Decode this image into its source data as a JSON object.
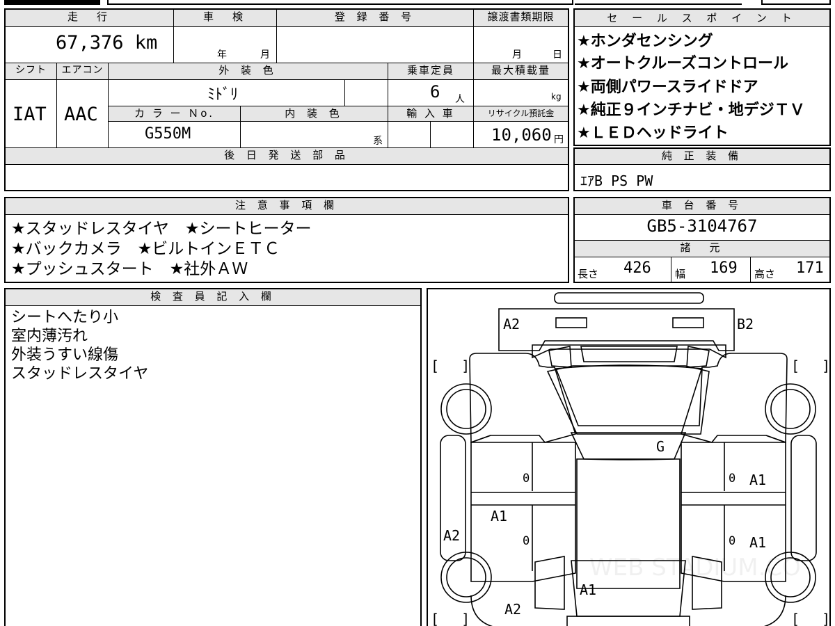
{
  "main": {
    "mileage_header": "走　行",
    "inspection_header": "車　検",
    "registration_header": "登 録 番 号",
    "transfer_header": "譲渡書類期限",
    "mileage": "67,376 km",
    "inspection_year": "年",
    "inspection_month": "月",
    "transfer_month": "月",
    "transfer_day": "日",
    "shift_header": "シフト",
    "ac_header": "エアコン",
    "exterior_header": "外 装 色",
    "capacity_header": "乗車定員",
    "load_header": "最大積載量",
    "shift": "IAT",
    "ac": "AAC",
    "exterior_color": "ﾐﾄﾞﾘ",
    "capacity": "6",
    "capacity_unit": "人",
    "load_unit": "kg",
    "colorno_header": "カ ラ ー Ｎo.",
    "interior_header": "内 装 色",
    "import_header": "輸 入 車",
    "recycle_header": "リサイクル預託金",
    "color_no": "G550M",
    "interior_unit": "系",
    "recycle_fee": "10,060",
    "recycle_unit": "円",
    "later_parts_header": "後 日 発 送 部 品"
  },
  "sales_points": {
    "header": "セ ー ル ス ポ イ ン ト",
    "items": [
      "★ホンダセンシング",
      "★オートクルーズコントロール",
      "★両側パワースライドドア",
      "★純正９インチナビ・地デジＴＶ",
      "★ＬＥＤヘッドライト"
    ]
  },
  "equipment": {
    "header": "純 正 装 備",
    "value": "ｴｱB PS PW"
  },
  "notes": {
    "header": "注 意 事 項 欄",
    "lines": [
      "★スタッドレスタイヤ　★シートヒーター",
      "★バックカメラ　★ビルトインＥＴＣ",
      "★プッシュスタート　★社外ＡＷ"
    ]
  },
  "chassis": {
    "header": "車 台 番 号",
    "value": "GB5-3104767"
  },
  "specs": {
    "header": "諸　元",
    "length_label": "長さ",
    "length": "426",
    "width_label": "幅",
    "width": "169",
    "height_label": "高さ",
    "height": "171"
  },
  "inspector": {
    "header": "検 査 員 記 入 欄",
    "lines": [
      "シートへたり小",
      "室内薄汚れ",
      "外装うすい線傷",
      "スタッドレスタイヤ"
    ]
  },
  "diagram": {
    "a2_front_left": "A2",
    "b2_front_right": "B2",
    "g_windshield": "G",
    "zero_left_front": "0",
    "zero_right_front": "0",
    "a1_right_front": "A1",
    "a1_left_rear": "A1",
    "zero_left_rear": "0",
    "zero_right_rear": "0",
    "a1_right_rear": "A1",
    "a2_left_side": "A2",
    "a1_rear": "A1",
    "a2_rear": "A2",
    "bracket_tl": "[　 ]",
    "bracket_tr": "[　 ]",
    "bracket_bl": "[　 ]",
    "bracket_br": "[　 ]",
    "watermark": "WEB STADIUM.CO"
  }
}
